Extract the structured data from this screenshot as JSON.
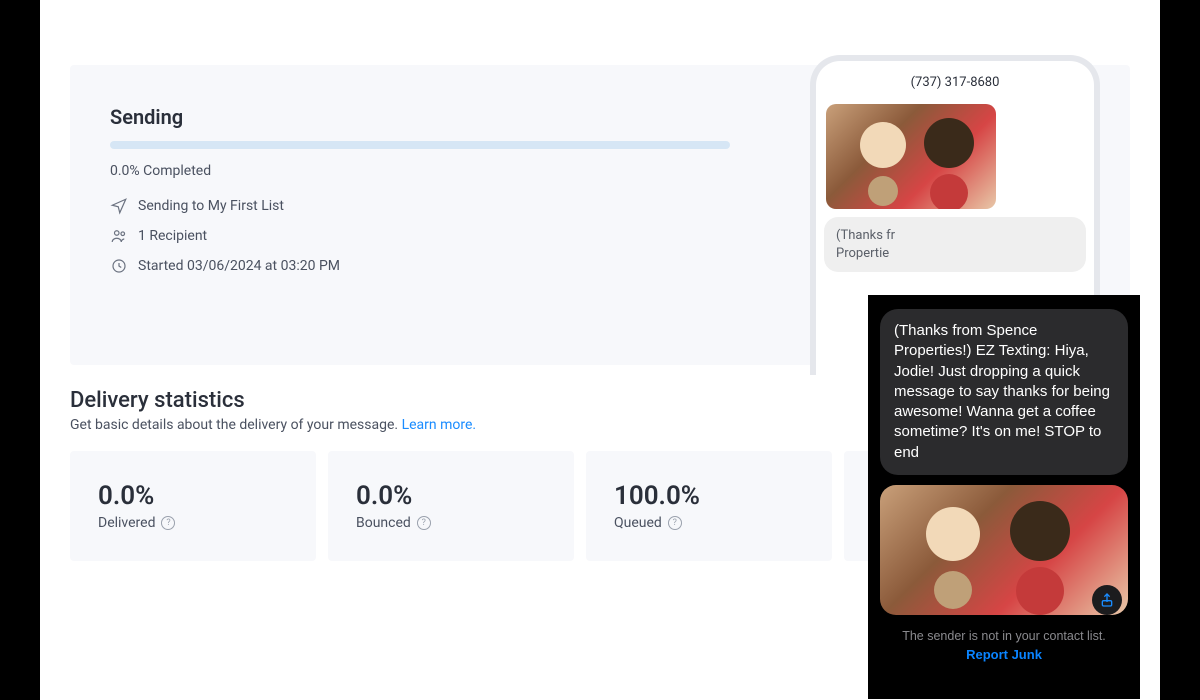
{
  "sending": {
    "title": "Sending",
    "progress_label": "0.0% Completed",
    "to_label": "Sending to My First List",
    "recipients_label": "1 Recipient",
    "started_label": "Started 03/06/2024 at 03:20 PM"
  },
  "phone": {
    "number": "(737) 317-8680",
    "bubble_truncated": "(Thanks fr\nPropertie"
  },
  "delivery": {
    "title": "Delivery statistics",
    "subtitle": "Get basic details about the delivery of your message. ",
    "learn_more": "Learn more.",
    "stats": [
      {
        "value": "0.0%",
        "label": "Delivered"
      },
      {
        "value": "0.0%",
        "label": "Bounced"
      },
      {
        "value": "100.0%",
        "label": "Queued"
      }
    ]
  },
  "overlay": {
    "message": "(Thanks from Spence Properties!) EZ Texting: Hiya, Jodie! Just dropping a quick message to say thanks for being awesome! Wanna get a coffee sometime? It's on me! STOP to end",
    "contact_note": "The sender is not in your contact list.",
    "report_junk": "Report Junk"
  }
}
